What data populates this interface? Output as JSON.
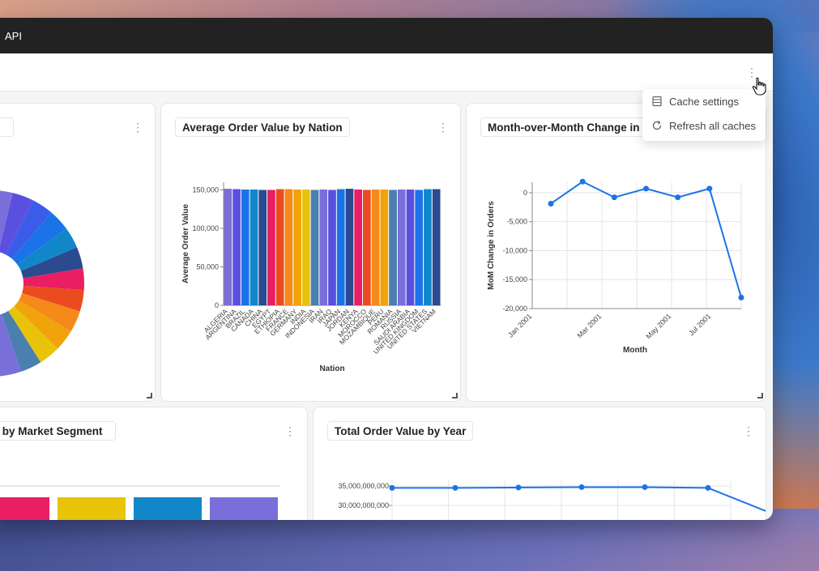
{
  "window": {
    "title": "API"
  },
  "menu": {
    "items": [
      "Cache settings",
      "Refresh all caches"
    ]
  },
  "cards": {
    "donut": {
      "title": ""
    },
    "aov": {
      "title": "Average Order Value by Nation"
    },
    "mom": {
      "title": "Month-over-Month Change in"
    },
    "segment": {
      "title": "ce by Market Segment"
    },
    "year": {
      "title": "Total Order Value by Year"
    }
  },
  "chart_data": [
    {
      "id": "donut",
      "type": "pie",
      "colors": [
        "#7a6fd8",
        "#5b4fe0",
        "#3b5ce8",
        "#1a73e8",
        "#1187c9",
        "#2b4a8f",
        "#e91e63",
        "#ea4c1f",
        "#f5891a",
        "#f0a30a",
        "#e8c30a",
        "#4a7fb0",
        "#7a6fd8",
        "#5b4fe0",
        "#1a73e8"
      ]
    },
    {
      "id": "aov",
      "type": "bar",
      "title": "Average Order Value by Nation",
      "xlabel": "Nation",
      "ylabel": "Average Order Value",
      "ylim": [
        0,
        160000
      ],
      "yticks": [
        "0",
        "50,000",
        "100,000",
        "150,000"
      ],
      "ytick_values": [
        0,
        50000,
        100000,
        150000
      ],
      "categories": [
        "ALGERIA",
        "ARGENTINA",
        "BRAZIL",
        "CANADA",
        "CHINA",
        "EGYPT",
        "ETHIOPIA",
        "FRANCE",
        "GERMANY",
        "INDIA",
        "INDONESIA",
        "IRAN",
        "IRAQ",
        "JAPAN",
        "JORDAN",
        "KENYA",
        "MOROCCO",
        "MOZAMBIQUE",
        "PERU",
        "ROMANIA",
        "RUSSIA",
        "SAUDI ARABIA",
        "UNITED KINGDOM",
        "UNITED STATES",
        "VIETNAM"
      ],
      "values": [
        151500,
        151000,
        150500,
        150500,
        150000,
        150000,
        151000,
        151000,
        150500,
        150500,
        150000,
        150500,
        150000,
        151000,
        151500,
        150500,
        150000,
        150500,
        150500,
        150000,
        150500,
        150500,
        150000,
        151000,
        151000
      ],
      "colors": [
        "#7a6fd8",
        "#5b4fe0",
        "#1a73e8",
        "#1187c9",
        "#2b4a8f",
        "#e91e63",
        "#ea4c1f",
        "#f5891a",
        "#f0a30a",
        "#e8c30a",
        "#4a7fb0",
        "#7a6fd8",
        "#5b4fe0",
        "#1a73e8",
        "#2b4a8f",
        "#e91e63",
        "#ea4c1f",
        "#f5891a",
        "#f0a30a",
        "#4a7fb0",
        "#7a6fd8",
        "#5b4fe0",
        "#1a73e8",
        "#1187c9",
        "#2b4a8f"
      ]
    },
    {
      "id": "mom",
      "type": "line",
      "xlabel": "Month",
      "ylabel": "MoM Change in Orders",
      "ylim": [
        -20000,
        1800
      ],
      "yticks": [
        "0",
        "-5,000",
        "-10,000",
        "-15,000",
        "-20,000"
      ],
      "ytick_values": [
        0,
        -5000,
        -10000,
        -15000,
        -20000
      ],
      "xticks": [
        "Jan 2001",
        "Mar 2001",
        "May 2001",
        "Jul 2001"
      ],
      "x": [
        "Feb 2001",
        "Mar 2001",
        "Apr 2001",
        "May 2001",
        "Jun 2001",
        "Jul 2001",
        "Aug 2001"
      ],
      "values": [
        -1900,
        1900,
        -800,
        700,
        -800,
        700,
        -18100
      ],
      "color": "#1a73e8"
    },
    {
      "id": "segment",
      "type": "bar",
      "colors": [
        "#e91e63",
        "#e8c30a",
        "#1187c9",
        "#7a6fd8"
      ]
    },
    {
      "id": "year",
      "type": "line",
      "title": "Total Order Value by Year",
      "yticks": [
        "35,000,000,000",
        "30,000,000,000"
      ],
      "ytick_values": [
        35000000000,
        30000000000
      ],
      "values": [
        34500000000,
        34500000000,
        34600000000,
        34700000000,
        34700000000,
        34500000000,
        28000000000
      ],
      "color": "#1a73e8"
    }
  ]
}
